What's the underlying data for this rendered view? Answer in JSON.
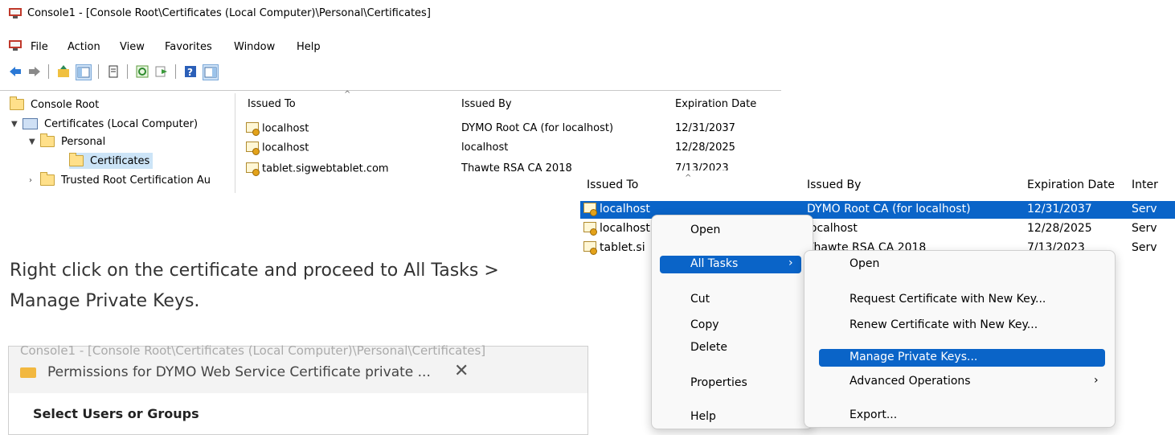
{
  "window": {
    "title": "Console1 - [Console Root\\Certificates (Local Computer)\\Personal\\Certificates]"
  },
  "menu": [
    "File",
    "Action",
    "View",
    "Favorites",
    "Window",
    "Help"
  ],
  "toolbar_icons": [
    "back-arrow-icon",
    "forward-arrow-icon",
    "up-folder-icon",
    "show-hide-tree-icon",
    "properties-icon",
    "refresh-icon",
    "export-list-icon",
    "help-icon",
    "show-hide-action-pane-icon"
  ],
  "tree": {
    "root": "Console Root",
    "certificates": "Certificates (Local Computer)",
    "personal": "Personal",
    "certs": "Certificates",
    "trusted": "Trusted Root Certification Au"
  },
  "list": {
    "headers": [
      "Issued To",
      "Issued By",
      "Expiration Date"
    ],
    "rows": [
      [
        "localhost",
        "DYMO Root CA (for localhost)",
        "12/31/2037"
      ],
      [
        "localhost",
        "localhost",
        "12/28/2025"
      ],
      [
        "tablet.sigwebtablet.com",
        "Thawte RSA CA 2018",
        "7/13/2023"
      ]
    ]
  },
  "instruction": "Right click on the certificate and proceed to All Tasks > Manage Private Keys.",
  "permissions": {
    "faded_title": "Console1 - [Console Root\\Certificates (Local Computer)\\Personal\\Certificates]",
    "title": "Permissions for DYMO Web Service Certificate private ...",
    "close": "✕",
    "section": "Select Users or Groups"
  },
  "overlay_list": {
    "headers": [
      "Issued To",
      "Issued By",
      "Expiration Date",
      "Inter"
    ],
    "rows": [
      [
        "localhost",
        "DYMO Root CA (for localhost)",
        "12/31/2037",
        "Serv"
      ],
      [
        "localhost",
        "localhost",
        "12/28/2025",
        "Serv"
      ],
      [
        "tablet.si",
        "Thawte RSA CA 2018",
        "7/13/2023",
        "Serv"
      ]
    ]
  },
  "context_menu": {
    "open": "Open",
    "all_tasks": "All Tasks",
    "all_tasks_arrow": "›",
    "cut": "Cut",
    "copy": "Copy",
    "delete": "Delete",
    "properties": "Properties",
    "help": "Help"
  },
  "submenu": {
    "open": "Open",
    "request": "Request Certificate with New Key...",
    "renew": "Renew Certificate with New Key...",
    "manage": "Manage Private Keys...",
    "advanced": "Advanced Operations",
    "advanced_arrow": "›",
    "export": "Export..."
  },
  "colors": {
    "selection": "#0a64c8",
    "menu_bg": "#f9f9f9"
  }
}
